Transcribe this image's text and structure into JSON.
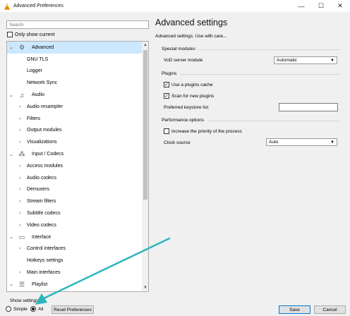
{
  "window": {
    "title": "Advanced Preferences",
    "minimize_glyph": "—",
    "maximize_glyph": "☐",
    "close_glyph": "✕"
  },
  "sidebar": {
    "search_placeholder": "Search",
    "only_show_current": "Only show current",
    "tree": [
      {
        "label": "Advanced",
        "level": 0,
        "expanded": true,
        "selected": true,
        "icon": "gear-icon"
      },
      {
        "label": "GNU TLS",
        "level": 1,
        "has_children": false
      },
      {
        "label": "Logger",
        "level": 1,
        "has_children": false
      },
      {
        "label": "Network Sync",
        "level": 1,
        "has_children": false
      },
      {
        "label": "Audio",
        "level": 0,
        "expanded": true,
        "icon": "music-note-icon"
      },
      {
        "label": "Audio resampler",
        "level": 1,
        "has_children": true
      },
      {
        "label": "Filters",
        "level": 1,
        "has_children": true
      },
      {
        "label": "Output modules",
        "level": 1,
        "has_children": true
      },
      {
        "label": "Visualizations",
        "level": 1,
        "has_children": true
      },
      {
        "label": "Input / Codecs",
        "level": 0,
        "expanded": true,
        "icon": "codec-icon"
      },
      {
        "label": "Access modules",
        "level": 1,
        "has_children": true
      },
      {
        "label": "Audio codecs",
        "level": 1,
        "has_children": true
      },
      {
        "label": "Demuxers",
        "level": 1,
        "has_children": true
      },
      {
        "label": "Stream filters",
        "level": 1,
        "has_children": true
      },
      {
        "label": "Subtitle codecs",
        "level": 1,
        "has_children": true
      },
      {
        "label": "Video codecs",
        "level": 1,
        "has_children": true
      },
      {
        "label": "Interface",
        "level": 0,
        "expanded": true,
        "icon": "interface-icon"
      },
      {
        "label": "Control interfaces",
        "level": 1,
        "has_children": true
      },
      {
        "label": "Hotkeys settings",
        "level": 1,
        "has_children": false
      },
      {
        "label": "Main interfaces",
        "level": 1,
        "has_children": true
      },
      {
        "label": "Playlist",
        "level": 0,
        "expanded": true,
        "icon": "playlist-icon"
      }
    ]
  },
  "main": {
    "heading": "Advanced settings",
    "subheading": "Advanced settings. Use with care...",
    "special_modules": {
      "title": "Special modules",
      "vod_label": "VoD server module",
      "vod_value": "Automatic"
    },
    "plugins": {
      "title": "Plugins",
      "use_cache_label": "Use a plugins cache",
      "use_cache_checked": true,
      "scan_label": "Scan for new plugins",
      "scan_checked": true,
      "keystore_label": "Preferred keystore list",
      "keystore_value": ""
    },
    "performance": {
      "title": "Performance options",
      "priority_label": "Increase the priority of the process",
      "priority_checked": false,
      "clock_label": "Clock source",
      "clock_value": "Auto"
    }
  },
  "footer": {
    "show_settings": "Show settings",
    "simple_label": "Simple",
    "all_label": "All",
    "selected": "All",
    "reset_label": "Reset Preferences",
    "save_label": "Save",
    "cancel_label": "Cancel"
  },
  "glyphs": {
    "expanded": "⌄",
    "collapsed": "›",
    "check": "✓",
    "caret": "▼",
    "scroll_up": "▲",
    "scroll_down": "▼"
  },
  "colors": {
    "selection": "#cce8ff",
    "annotation_arrow": "#2bb5c0",
    "default_button_border": "#0078d7"
  }
}
